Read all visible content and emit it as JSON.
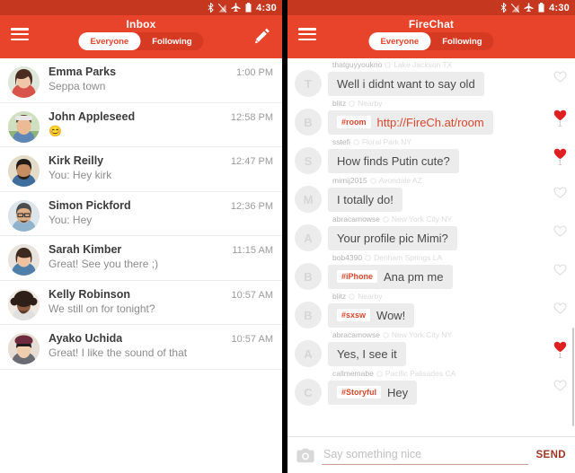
{
  "status_bar": {
    "time": "4:30",
    "icons": [
      "bluetooth-icon",
      "signal-off-icon",
      "airplane-mode-icon",
      "battery-icon"
    ]
  },
  "colors": {
    "app_bar": "#e8432b",
    "status_bar": "#c5371f",
    "tab_track": "#d63a22",
    "accent_red": "#d9472d",
    "heart_filled": "#e02020"
  },
  "left_panel": {
    "title": "Inbox",
    "menu_icon": "hamburger-icon",
    "compose_icon": "pencil-icon",
    "tabs": [
      {
        "label": "Everyone",
        "active": true
      },
      {
        "label": "Following",
        "active": false
      }
    ],
    "conversations": [
      {
        "name": "Emma Parks",
        "snippet": "Seppa town",
        "time": "1:00 PM",
        "avatar": "avatar-emma-parks"
      },
      {
        "name": "John Appleseed",
        "snippet": "😊",
        "time": "12:58 PM",
        "avatar": "avatar-john-appleseed"
      },
      {
        "name": "Kirk Reilly",
        "snippet": "You: Hey kirk",
        "time": "12:47 PM",
        "avatar": "avatar-kirk-reilly"
      },
      {
        "name": "Simon Pickford",
        "snippet": "You: Hey",
        "time": "12:36 PM",
        "avatar": "avatar-simon-pickford"
      },
      {
        "name": "Sarah Kimber",
        "snippet": "Great! See you there ;)",
        "time": "11:15 AM",
        "avatar": "avatar-sarah-kimber"
      },
      {
        "name": "Kelly Robinson",
        "snippet": "We still on for tonight?",
        "time": "10:57 AM",
        "avatar": "avatar-kelly-robinson"
      },
      {
        "name": "Ayako Uchida",
        "snippet": "Great! I like the sound of that",
        "time": "10:57 AM",
        "avatar": "avatar-ayako-uchida"
      }
    ]
  },
  "right_panel": {
    "title": "FireChat",
    "menu_icon": "hamburger-icon",
    "tabs": [
      {
        "label": "Everyone",
        "active": true
      },
      {
        "label": "Following",
        "active": false
      }
    ],
    "messages": [
      {
        "username": "thatguyyoukno",
        "location": "Lake Jackson TX",
        "initial": "T",
        "tag": "",
        "text": "Well i didnt want to say old",
        "liked": false,
        "like_count": ""
      },
      {
        "username": "blitz",
        "location": "Nearby",
        "initial": "B",
        "tag": "#room",
        "text": "http://FireCh.at/room",
        "liked": true,
        "like_count": "1",
        "text_is_link": true
      },
      {
        "username": "sstefi",
        "location": "Floral Park NY",
        "initial": "S",
        "tag": "",
        "text": "How finds Putin cute?",
        "liked": true,
        "like_count": "1"
      },
      {
        "username": "mimij2015",
        "location": "Avondale AZ",
        "initial": "M",
        "tag": "",
        "text": "I totally do!",
        "liked": false,
        "like_count": ""
      },
      {
        "username": "abracamowse",
        "location": "New York City NY",
        "initial": "A",
        "tag": "",
        "text": "Your profile pic Mimi?",
        "liked": false,
        "like_count": ""
      },
      {
        "username": "bob4390",
        "location": "Denham Springs LA",
        "initial": "B",
        "tag": "#iPhone",
        "text": "Ana pm me",
        "liked": false,
        "like_count": ""
      },
      {
        "username": "blitz",
        "location": "Nearby",
        "initial": "B",
        "tag": "#sxsw",
        "text": "Wow!",
        "liked": false,
        "like_count": ""
      },
      {
        "username": "abracamowse",
        "location": "New York City NY",
        "initial": "A",
        "tag": "",
        "text": "Yes,  I see it",
        "liked": true,
        "like_count": "1"
      },
      {
        "username": "callmemabe",
        "location": "Pacific Palisades CA",
        "initial": "C",
        "tag": "#Storyful",
        "text": "Hey",
        "liked": false,
        "like_count": ""
      }
    ],
    "composer": {
      "camera_icon": "camera-icon",
      "placeholder": "Say something nice",
      "value": "",
      "send_label": "SEND"
    }
  }
}
